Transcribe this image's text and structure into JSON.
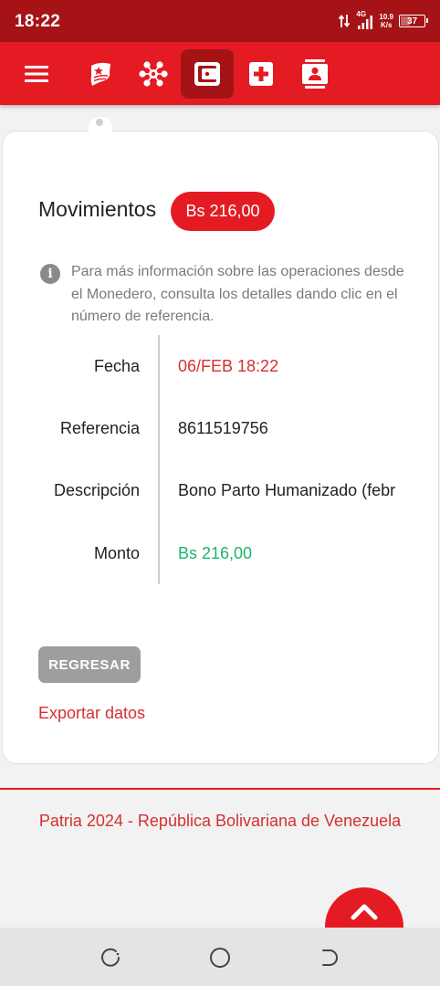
{
  "status_bar": {
    "time": "18:22",
    "network": "4G",
    "speed_value": "10.9",
    "speed_unit": "K/s",
    "battery": "37",
    "battery_level": 0.37
  },
  "nav": {
    "icons": [
      "menu-icon",
      "carnet-flag-icon",
      "network-nodes-icon",
      "wallet-icon",
      "health-cross-icon",
      "contact-card-icon"
    ],
    "active": "wallet-icon",
    "colors": {
      "bar": "#e41b23",
      "active": "#a51316",
      "status": "#a51316"
    }
  },
  "movement": {
    "title": "Movimientos",
    "badge_amount": "Bs 216,00",
    "info_text": "Para más información sobre las operaciones desde el Monedero, consulta los detalles dando clic en el número de referencia.",
    "rows": [
      {
        "label": "Fecha",
        "value": "06/FEB 18:22"
      },
      {
        "label": "Referencia",
        "value": "8611519756"
      },
      {
        "label": "Descripción",
        "value": "Bono Parto Humanizado (febr"
      },
      {
        "label": "Monto",
        "value": "Bs 216,00"
      }
    ]
  },
  "actions": {
    "back_label": "REGRESAR",
    "export_label": "Exportar datos"
  },
  "footer": {
    "text": "Patria 2024 - República Bolivariana de Venezuela"
  },
  "colors": {
    "accent_red": "#e41b23",
    "date_red": "#d62f2f",
    "amount_green": "#1bb56a",
    "back_button": "#9e9e9e"
  }
}
